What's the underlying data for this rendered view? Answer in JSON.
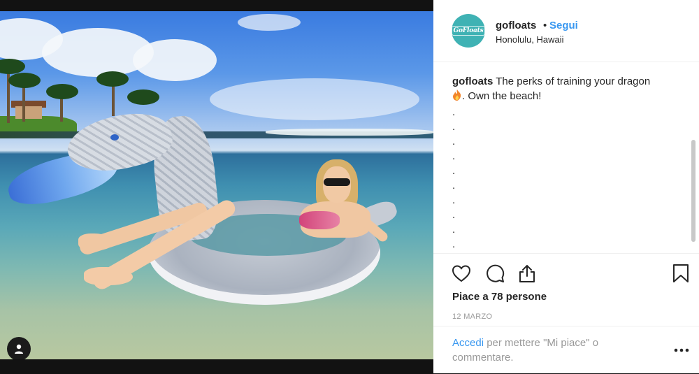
{
  "post": {
    "username": "gofloats",
    "separator": "•",
    "follow_label": "Segui",
    "location": "Honolulu, Hawaii",
    "avatar_logo_text": "GoFloats",
    "caption_username": "gofloats",
    "caption_text_1": "The perks of training your dragon",
    "caption_text_2": ". Own the beach!",
    "caption_dots": [
      ".",
      ".",
      ".",
      ".",
      ".",
      ".",
      ".",
      ".",
      ".",
      "."
    ],
    "likes_text": "Piace a 78 persone",
    "date_text": "12 MARZO",
    "login_link": "Accedi",
    "login_rest": " per mettere \"Mi piace\" o commentare."
  },
  "icons": {
    "like": "heart-icon",
    "comment": "comment-bubble-icon",
    "share": "share-icon",
    "save": "bookmark-icon",
    "more": "more-options-icon",
    "user_tag": "user-tag-icon",
    "emoji": "fire-emoji"
  },
  "colors": {
    "link_blue": "#3897f0",
    "text_dark": "#262626",
    "text_muted": "#999999",
    "avatar_teal": "#3fb2b4"
  }
}
